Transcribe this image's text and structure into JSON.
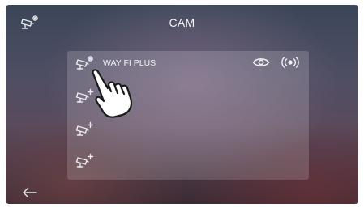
{
  "header": {
    "title": "CAM",
    "left_icon": "camera-settings-icon"
  },
  "camera_list": {
    "items": [
      {
        "label": "WAY FI PLUS",
        "icon": "camera-settings-icon",
        "actions": [
          "eye-icon",
          "live-broadcast-icon"
        ]
      },
      {
        "label": "",
        "icon": "camera-add-icon"
      },
      {
        "label": "",
        "icon": "camera-add-icon"
      },
      {
        "label": "",
        "icon": "camera-add-icon"
      }
    ]
  },
  "footer": {
    "back_icon": "back-arrow-icon"
  },
  "overlay": {
    "pointer": "hand-pointer-icon"
  },
  "colors": {
    "text": "#f2f2f4",
    "panel": "rgba(255,255,255,0.16)"
  }
}
